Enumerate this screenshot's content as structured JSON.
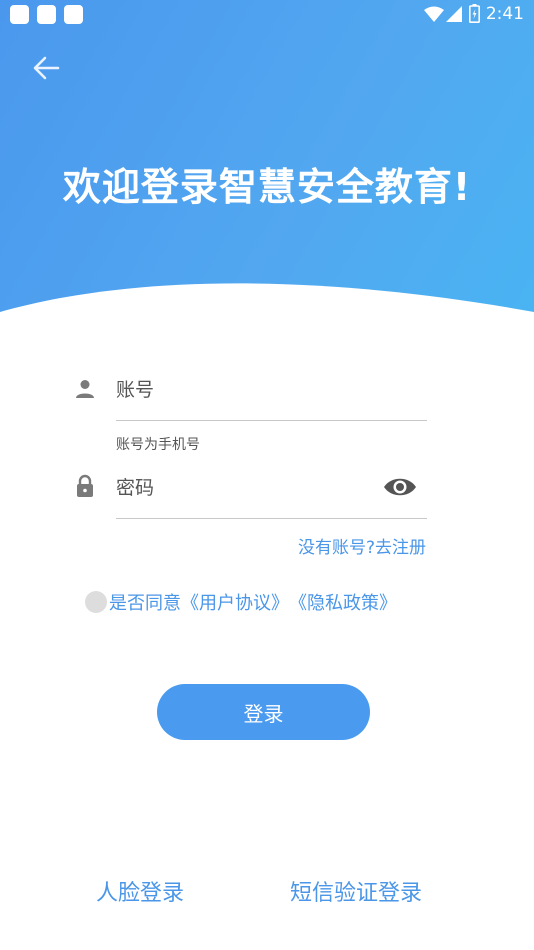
{
  "status_bar": {
    "time": "2:41"
  },
  "header": {
    "title": "欢迎登录智慧安全教育!"
  },
  "form": {
    "account_placeholder": "账号",
    "account_hint": "账号为手机号",
    "password_placeholder": "密码",
    "register_link": "没有账号?去注册"
  },
  "agreement": {
    "prefix": "是否同意",
    "user_agreement": "《用户协议》",
    "privacy_policy": "《隐私政策》",
    "checked": false
  },
  "login_button": "登录",
  "bottom_links": {
    "face_login": "人脸登录",
    "sms_login": "短信验证登录"
  },
  "colors": {
    "primary": "#4a9aef",
    "link": "#4a96e8",
    "header_gradient_start": "#4a98ee",
    "header_gradient_end": "#49b4f2"
  },
  "icons": [
    "back-arrow-icon",
    "user-icon",
    "lock-icon",
    "eye-icon",
    "wifi-icon",
    "signal-icon",
    "battery-icon"
  ]
}
